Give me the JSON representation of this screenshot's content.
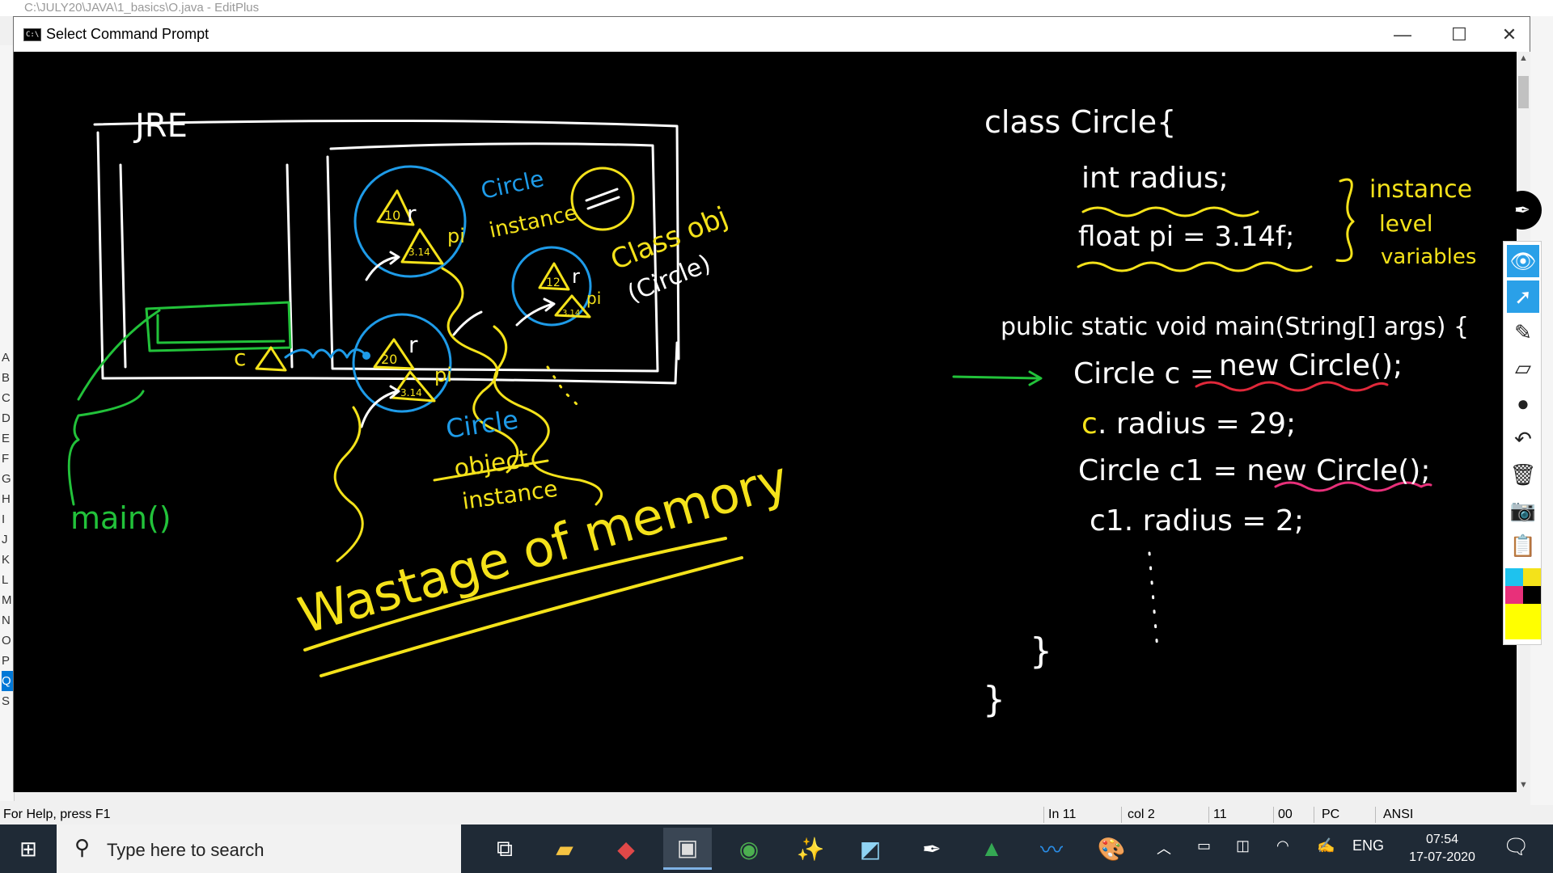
{
  "background_app": {
    "title": "C:\\JULY20\\JAVA\\1_basics\\O.java - EditPlus",
    "letters": [
      "A",
      "B",
      "C",
      "D",
      "E",
      "F",
      "G",
      "H",
      "I",
      "J",
      "K",
      "L",
      "M",
      "N",
      "O",
      "P",
      "Q",
      "S"
    ],
    "selected_letter": "Q"
  },
  "cmd_window": {
    "title": "Select Command Prompt",
    "icon_text": "C:\\",
    "minimize": "—",
    "maximize": "☐",
    "close": "✕"
  },
  "whiteboard": {
    "jre_label": "JRE",
    "main_label": "main()",
    "ref_c_label": "c",
    "objects": [
      {
        "r": "10",
        "pi": "3.14",
        "label": "Circle instance"
      },
      {
        "r": "20",
        "pi": "3.14",
        "label": "Circle object instance"
      },
      {
        "r": "12",
        "pi": "3.14"
      }
    ],
    "label_r": "r",
    "label_pi": "pi",
    "label_circle_instance_1": "Circle",
    "label_circle_instance_2": "instance",
    "label_class_obj_1": "Class obj",
    "label_class_obj_2": "(Circle)",
    "label_circle_object_1": "Circle",
    "label_circle_object_2": "object",
    "label_circle_object_3": "instance",
    "wastage": "Wastage of memory",
    "code": {
      "line1": "class  Circle{",
      "line2": "int  radius;",
      "line3": "float  pi = 3.14f;",
      "brace_note_1": "instance",
      "brace_note_2": "level",
      "brace_note_3": "variables",
      "line4": "public static void main(String[] args) {",
      "line5_a": "Circle  c = ",
      "line5_b": "new  Circle();",
      "line6_a": "c",
      "line6_b": ". radius  =  29;",
      "line7": "Circle  c1  =  new Circle();",
      "line8": "c1. radius  =  2;",
      "close1": "}",
      "close2": "}"
    }
  },
  "colors": {
    "white": "#ffffff",
    "blue": "#1e9be8",
    "yellow": "#f4e21a",
    "green": "#22c23a",
    "red": "#e0283a",
    "pink": "#e8307a"
  },
  "statusbar": {
    "help": "For Help, press F1",
    "ln": "In 11",
    "col": "col 2",
    "v1": "11",
    "v2": "00",
    "mode": "PC",
    "enc": "ANSI"
  },
  "annot_tools": [
    "pen-icon",
    "eye-icon",
    "pointer-icon",
    "highlighter-icon",
    "eraser-icon",
    "dot-icon",
    "undo-icon",
    "trash-icon",
    "camera-icon",
    "clipboard-icon"
  ],
  "taskbar": {
    "search_placeholder": "Type here to search",
    "lang": "ENG",
    "time": "07:54",
    "date": "17-07-2020"
  }
}
